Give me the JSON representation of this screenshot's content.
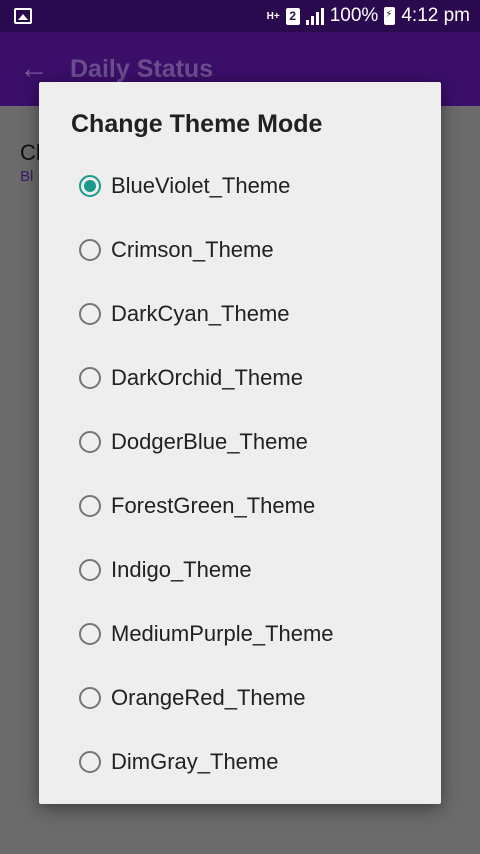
{
  "status_bar": {
    "network": "H+",
    "sim": "2",
    "battery": "100%",
    "time": "4:12 pm",
    "icons": [
      "gallery-icon",
      "signal-icon",
      "battery-charging-icon"
    ]
  },
  "app_bar": {
    "title": "Daily Status",
    "back_icon": "←"
  },
  "background": {
    "title": "Cl",
    "subtitle": "Bl"
  },
  "dialog": {
    "title": "Change Theme Mode",
    "accent": "#1a9a8a",
    "selected": "BlueViolet_Theme",
    "options": [
      {
        "label": "BlueViolet_Theme",
        "checked": true
      },
      {
        "label": "Crimson_Theme",
        "checked": false
      },
      {
        "label": "DarkCyan_Theme",
        "checked": false
      },
      {
        "label": "DarkOrchid_Theme",
        "checked": false
      },
      {
        "label": "DodgerBlue_Theme",
        "checked": false
      },
      {
        "label": "ForestGreen_Theme",
        "checked": false
      },
      {
        "label": "Indigo_Theme",
        "checked": false
      },
      {
        "label": "MediumPurple_Theme",
        "checked": false
      },
      {
        "label": "OrangeRed_Theme",
        "checked": false
      },
      {
        "label": "DimGray_Theme",
        "checked": false
      }
    ]
  }
}
